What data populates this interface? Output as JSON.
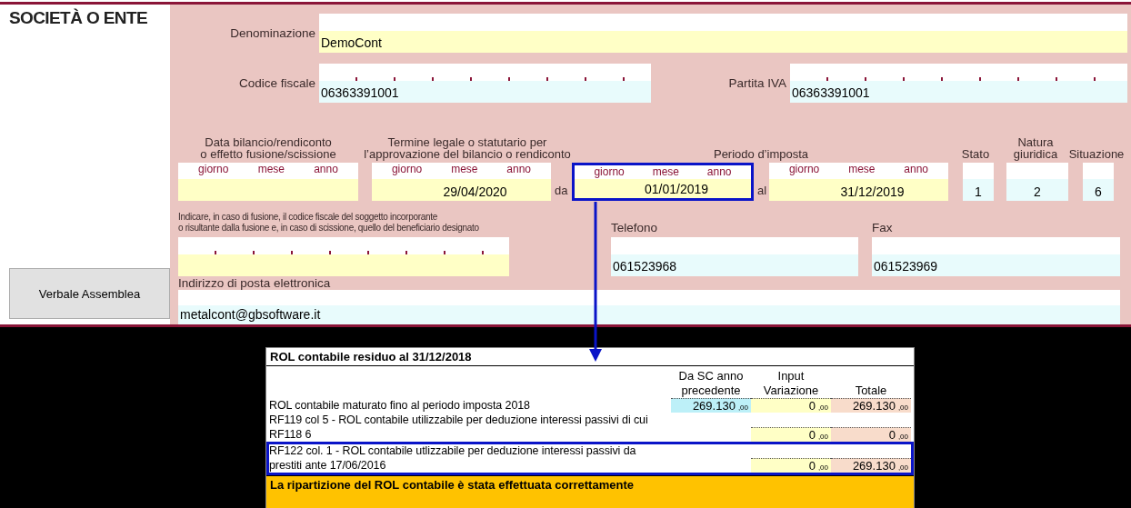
{
  "section_title": "SOCIETÀ O ENTE",
  "verbale_button": "Verbale Assemblea",
  "denominazione": {
    "label": "Denominazione",
    "value": "DemoCont"
  },
  "codice_fiscale": {
    "label": "Codice fiscale",
    "value": "06363391001"
  },
  "partita_iva": {
    "label": "Partita IVA",
    "value": "06363391001"
  },
  "date_headers": [
    [
      "Data bilancio/rendiconto",
      "o effetto fusione/scissione"
    ],
    [
      "Termine legale o statutario per",
      "l’approvazione del bilancio o rendiconto"
    ],
    [
      "Periodo d’imposta"
    ]
  ],
  "dates": [
    {
      "parts": [
        "giorno",
        "mese",
        "anno"
      ],
      "highlighted": false
    },
    {
      "parts": [
        "giorno",
        "mese",
        "anno"
      ],
      "value": "29/04/2020",
      "highlighted": false
    },
    {
      "prefix": "da",
      "parts": [
        "giorno",
        "mese",
        "anno"
      ],
      "value": "01/01/2019",
      "highlighted": true
    },
    {
      "prefix": "al",
      "parts": [
        "giorno",
        "mese",
        "anno"
      ],
      "value": "31/12/2019",
      "highlighted": false
    }
  ],
  "codes": [
    {
      "label": [
        "Stato"
      ],
      "value": "1"
    },
    {
      "label": [
        "Natura",
        "giuridica"
      ],
      "value": "2"
    },
    {
      "label": [
        "Situazione"
      ],
      "value": "6"
    }
  ],
  "fusion_note": [
    "Indicare, in caso di fusione, il codice fiscale del soggetto incorporante",
    "o risultante dalla fusione e, in caso di scissione, quello del beneficiario designato"
  ],
  "telefono": {
    "label": "Telefono",
    "value": "061523968"
  },
  "fax": {
    "label": "Fax",
    "value": "061523969"
  },
  "email": {
    "label": "Indirizzo di posta elettronica",
    "value": "metalcont@gbsoftware.it"
  },
  "rol_table": {
    "title": "ROL contabile residuo al 31/12/2018",
    "columns": [
      "Da SC anno precedente",
      "Input Variazione",
      "Totale"
    ],
    "rows": [
      {
        "label": "ROL contabile maturato fino al periodo imposta 2018",
        "highlighted": false,
        "cells": [
          {
            "value": "269.130",
            "decimals": ",00"
          },
          {
            "value": "0",
            "decimals": ",00"
          },
          {
            "value": "269.130",
            "decimals": ",00"
          }
        ]
      },
      {
        "label": "RF119 col 5  - ROL contabile utilizzabile per deduzione interessi passivi di cui RF118  6",
        "highlighted": false,
        "cells": [
          null,
          {
            "value": "0",
            "decimals": ",00"
          },
          {
            "value": "0",
            "decimals": ",00"
          }
        ]
      },
      {
        "label": "RF122 col. 1 - ROL contabile utlizzabile per deduzione interessi passivi da prestiti ante 17/06/2016",
        "highlighted": true,
        "cells": [
          null,
          {
            "value": "0",
            "decimals": ",00"
          },
          {
            "value": "269.130",
            "decimals": ",00"
          }
        ]
      }
    ],
    "message": "La ripartizione del ROL contabile è stata effettuata correttamente"
  }
}
